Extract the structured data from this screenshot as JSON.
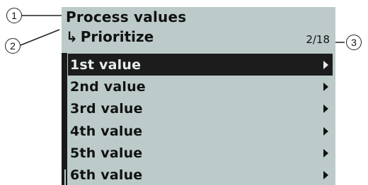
{
  "header": {
    "title": "Process values",
    "subtitle_arrow": "↳",
    "subtitle": "Prioritize",
    "counter": "2/18"
  },
  "menu": {
    "selected_index": 0,
    "items": [
      {
        "label": "1st value"
      },
      {
        "label": "2nd value"
      },
      {
        "label": "3rd value"
      },
      {
        "label": "4th value"
      },
      {
        "label": "5th value"
      },
      {
        "label": "6th value"
      }
    ]
  },
  "callouts": [
    "1",
    "2",
    "3"
  ],
  "icons": {
    "submenu_arrow": "chevron-right-icon",
    "return_arrow": "return-arrow-icon"
  },
  "colors": {
    "lcd_background": "#bccaca",
    "selection_background": "#1c1c1c",
    "text": "#111111"
  }
}
